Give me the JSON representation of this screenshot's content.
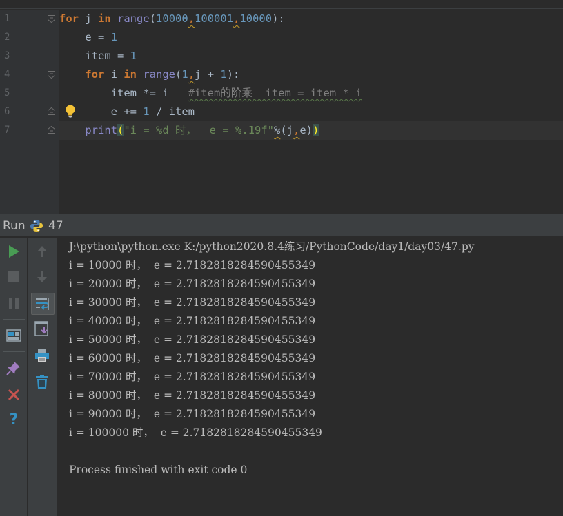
{
  "editor": {
    "line_numbers": [
      "1",
      "2",
      "3",
      "4",
      "5",
      "6",
      "7"
    ],
    "lines": [
      {
        "tokens": [
          {
            "t": "for",
            "c": "kw"
          },
          {
            "t": " j ",
            "c": ""
          },
          {
            "t": "in",
            "c": "kw"
          },
          {
            "t": " ",
            "c": ""
          },
          {
            "t": "range",
            "c": "fn"
          },
          {
            "t": "(",
            "c": ""
          },
          {
            "t": "10000",
            "c": "num"
          },
          {
            "t": ",",
            "c": "sep warn"
          },
          {
            "t": "100001",
            "c": "num"
          },
          {
            "t": ",",
            "c": "sep warn"
          },
          {
            "t": "10000",
            "c": "num"
          },
          {
            "t": "):",
            "c": ""
          }
        ]
      },
      {
        "tokens": [
          {
            "t": "    e = ",
            "c": ""
          },
          {
            "t": "1",
            "c": "num"
          }
        ]
      },
      {
        "tokens": [
          {
            "t": "    item = ",
            "c": ""
          },
          {
            "t": "1",
            "c": "num"
          }
        ]
      },
      {
        "tokens": [
          {
            "t": "    ",
            "c": ""
          },
          {
            "t": "for",
            "c": "kw"
          },
          {
            "t": " i ",
            "c": ""
          },
          {
            "t": "in",
            "c": "kw"
          },
          {
            "t": " ",
            "c": ""
          },
          {
            "t": "range",
            "c": "fn"
          },
          {
            "t": "(",
            "c": ""
          },
          {
            "t": "1",
            "c": "num"
          },
          {
            "t": ",",
            "c": "sep warn"
          },
          {
            "t": "j + ",
            "c": ""
          },
          {
            "t": "1",
            "c": "num"
          },
          {
            "t": "):",
            "c": ""
          }
        ]
      },
      {
        "tokens": [
          {
            "t": "        item *= i   ",
            "c": ""
          },
          {
            "t": "#item的阶乘  item = item * i",
            "c": "cmt"
          }
        ]
      },
      {
        "tokens": [
          {
            "t": "        e += ",
            "c": ""
          },
          {
            "t": "1",
            "c": "num"
          },
          {
            "t": " / item",
            "c": ""
          }
        ]
      },
      {
        "tokens": [
          {
            "t": "    ",
            "c": ""
          },
          {
            "t": "print",
            "c": "fn"
          },
          {
            "t": "(",
            "c": "paren-hl"
          },
          {
            "t": "\"i = %d 时，  e = %.19f\"",
            "c": "str"
          },
          {
            "t": "%",
            "c": "warn"
          },
          {
            "t": "(j",
            "c": ""
          },
          {
            "t": ",",
            "c": "sep warn"
          },
          {
            "t": "e)",
            "c": ""
          },
          {
            "t": ")",
            "c": "paren-hl"
          }
        ]
      }
    ],
    "current_line": 7
  },
  "run_panel": {
    "title": "Run",
    "config_name": "47",
    "console_lines": [
      "J:\\python\\python.exe K:/python2020.8.4练习/PythonCode/day1/day03/47.py",
      "i = 10000 时，  e = 2.7182818284590455349",
      "i = 20000 时，  e = 2.7182818284590455349",
      "i = 30000 时，  e = 2.7182818284590455349",
      "i = 40000 时，  e = 2.7182818284590455349",
      "i = 50000 时，  e = 2.7182818284590455349",
      "i = 60000 时，  e = 2.7182818284590455349",
      "i = 70000 时，  e = 2.7182818284590455349",
      "i = 80000 时，  e = 2.7182818284590455349",
      "i = 90000 时，  e = 2.7182818284590455349",
      "i = 100000 时，  e = 2.7182818284590455349",
      "",
      "Process finished with exit code 0"
    ]
  },
  "colors": {
    "editor_bg": "#2b2b2b",
    "gutter_bg": "#313335",
    "panel_bg": "#3c3f41",
    "keyword": "#cc7832",
    "number": "#6897bb",
    "builtin": "#8888c6",
    "string": "#6a8759",
    "comment": "#808080",
    "run_green": "#499c54",
    "close_red": "#c75450",
    "help_blue": "#3592c4"
  }
}
